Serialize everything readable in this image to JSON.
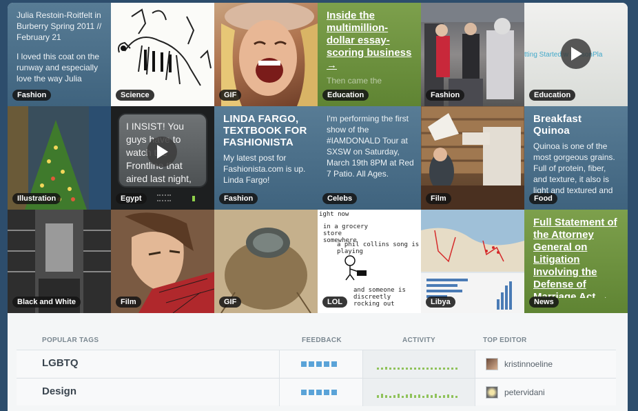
{
  "tiles": [
    {
      "tag": "Fashion",
      "kind": "text-blue",
      "body": "Julia Restoin-Roitfelt in Burberry Spring 2011 // February 21",
      "body2": "I loved this coat on the runway and especially love the way Julia"
    },
    {
      "tag": "Science",
      "kind": "image",
      "icon": "dinosaur-skeleton-illustration"
    },
    {
      "tag": "GIF",
      "kind": "image",
      "icon": "laughing-woman-photo"
    },
    {
      "tag": "Education",
      "kind": "text-green",
      "link": "Inside the multimillion-dollar essay-scoring business →",
      "fade": "Then came the"
    },
    {
      "tag": "Fashion",
      "kind": "image",
      "icon": "street-crowd-photo"
    },
    {
      "tag": "Education",
      "kind": "video",
      "video_text": "tting Started w LessonPla"
    },
    {
      "tag": "Illustration",
      "kind": "image",
      "icon": "christmas-tree-painting"
    },
    {
      "tag": "Egypt",
      "kind": "video-tv",
      "tv_text": "I INSIST! You guys have to watch the Frontline that aired last night,"
    },
    {
      "tag": "Fashion",
      "kind": "text-blue",
      "head": "LINDA FARGO, TEXTBOOK FOR FASHIONISTA",
      "body": "My latest post for Fashionista.com is up. Linda Fargo!"
    },
    {
      "tag": "Celebs",
      "kind": "text-blue",
      "body": "I'm performing the first show of the #IAMDONALD Tour at SXSW on Saturday, March 19th 8PM at Red 7 Patio. All Ages."
    },
    {
      "tag": "Film",
      "kind": "image",
      "icon": "log-cabin-interior-photo"
    },
    {
      "tag": "Food",
      "kind": "text-blue",
      "head": "Breakfast Quinoa",
      "body": "Quinoa is one of the most gorgeous grains. Full of protein, fiber, and texture, it also is light and textured and easy to"
    },
    {
      "tag": "Black and White",
      "kind": "image",
      "icon": "library-bookshelves-photo"
    },
    {
      "tag": "Film",
      "kind": "image",
      "icon": "spiderman-illustration"
    },
    {
      "tag": "GIF",
      "kind": "image",
      "icon": "fly-closeup-photo"
    },
    {
      "tag": "LOL",
      "kind": "comic",
      "comic_lines": [
        "ight now",
        "in a grocery store somewhere",
        "a phil collins song is playing",
        "and someone is discreetly rocking out"
      ]
    },
    {
      "tag": "Libya",
      "kind": "image",
      "icon": "libya-map-infographic"
    },
    {
      "tag": "News",
      "kind": "text-green",
      "link": "Full Statement of the Attorney General on Litigation Involving the Defense of Marriage Act →"
    }
  ],
  "table": {
    "headers": {
      "tags": "POPULAR TAGS",
      "feedback": "FEEDBACK",
      "activity": "ACTIVITY",
      "editor": "TOP EDITOR"
    },
    "rows": [
      {
        "name": "LGBTQ",
        "editor": "kristinnoeline",
        "feedback": 5
      },
      {
        "name": "Design",
        "editor": "petervidani",
        "feedback": 5
      }
    ]
  },
  "colors": {
    "background": "#2d4d6c",
    "tile_blue": "#4a6e88",
    "tile_green": "#6f9240",
    "feedback_dot": "#5aa3d8",
    "activity_bar": "#8fc25a"
  }
}
